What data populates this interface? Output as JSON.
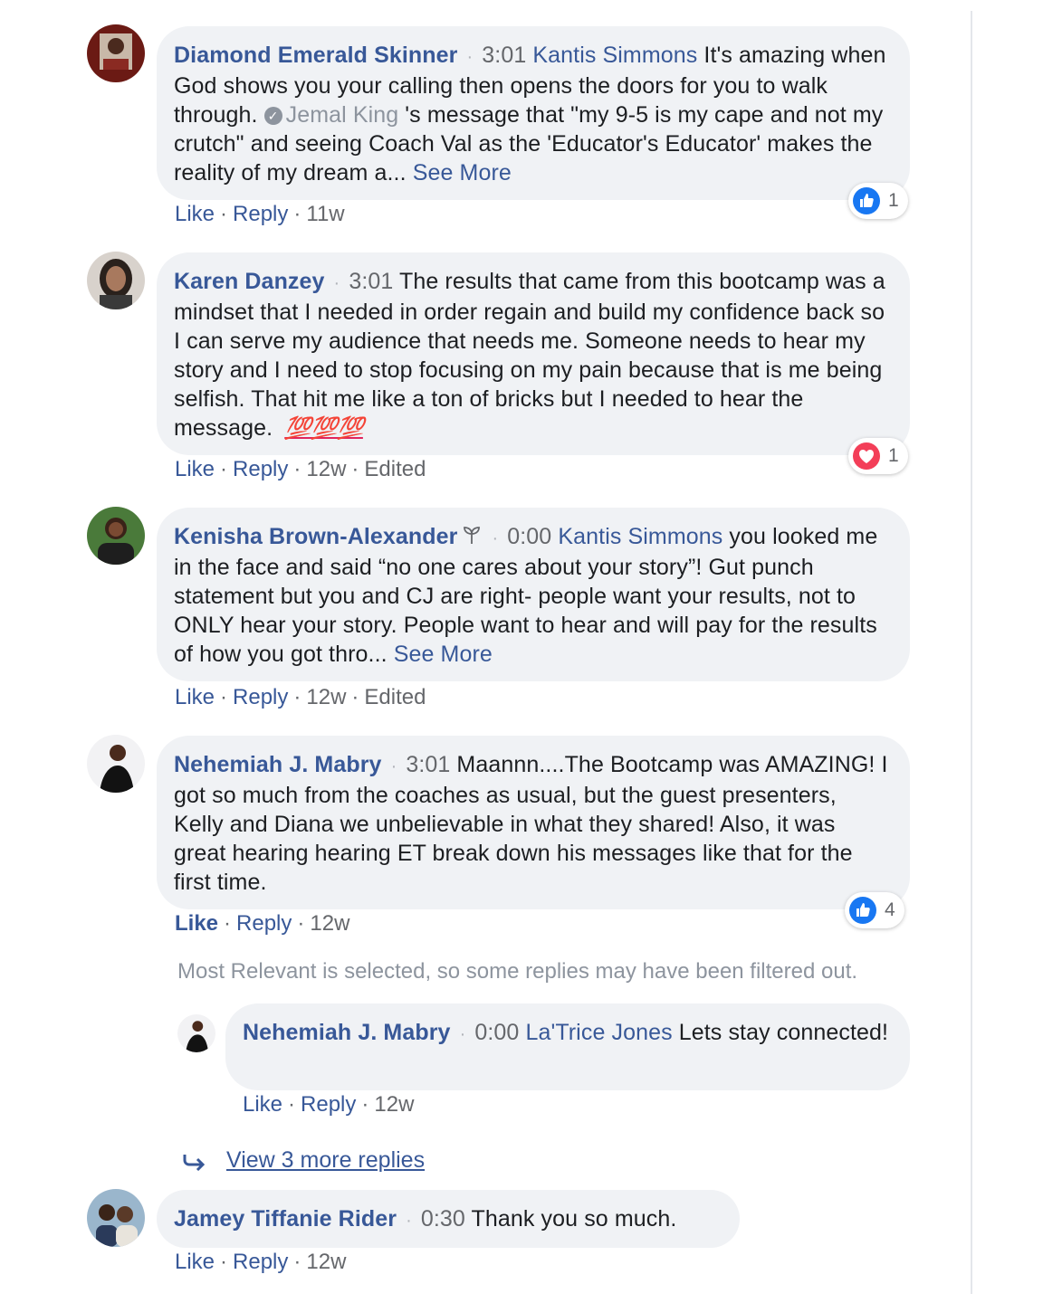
{
  "comments": [
    {
      "author": "Diamond Emerald Skinner",
      "time": "3:01",
      "mention": "Kantis Simmons",
      "text1": " It's amazing when God shows you your calling then opens the doors for you to walk through. ",
      "mention2": "Jemal King",
      "text2": " 's message that \"my 9-5 is my cape and not my crutch\" and seeing Coach Val as the 'Educator's Educator' makes the reality of my dream a... ",
      "see_more": "See More",
      "like": "Like",
      "reply": "Reply",
      "age": "11w",
      "reaction": {
        "type": "like",
        "count": "1"
      }
    },
    {
      "author": "Karen Danzey",
      "time": "3:01",
      "text1": " The results that came from this bootcamp was a mindset that I needed in order regain and build my confidence back so I can serve my audience that needs me. Someone needs to hear my story and I need to stop focusing on my pain because that is me being selfish. That hit me like a ton of bricks but I needed to hear the message. ",
      "emoji": "💯💯💯",
      "like": "Like",
      "reply": "Reply",
      "age": "12w",
      "edited": "Edited",
      "reaction": {
        "type": "love",
        "count": "1"
      }
    },
    {
      "author": "Kenisha Brown-Alexander",
      "time": "0:00",
      "mention": "Kantis Simmons",
      "text1": " you looked me in the face and said “no one cares about your story”! Gut punch statement but you and CJ are right- people want your results, not to ONLY hear your story. People want to hear and will pay for the results of how you got thro... ",
      "see_more": "See More",
      "like": "Like",
      "reply": "Reply",
      "age": "12w",
      "edited": "Edited"
    },
    {
      "author": "Nehemiah J. Mabry",
      "time": "3:01",
      "text1": " Maannn....The Bootcamp was AMAZING! I got so much from the coaches as usual, but the guest presenters, Kelly and Diana we unbelievable in what they shared! Also, it was great hearing hearing ET break down his messages like that for the first time.",
      "like": "Like",
      "reply": "Reply",
      "age": "12w",
      "reaction": {
        "type": "like",
        "count": "4"
      }
    },
    {
      "author": "Jamey Tiffanie Rider",
      "time": "0:30",
      "text1": " Thank you so much.",
      "like": "Like",
      "reply": "Reply",
      "age": "12w"
    }
  ],
  "reply": {
    "author": "Nehemiah J. Mabry",
    "time": "0:00",
    "mention": "La'Trice Jones",
    "text1": " Lets stay connected!",
    "like": "Like",
    "reply": "Reply",
    "age": "12w"
  },
  "notice": "Most Relevant is selected, so some replies may have been filtered out.",
  "view_more": "View 3 more replies",
  "separator_dot": "·",
  "colors": {
    "link_blue": "#385898",
    "bubble_bg": "#f0f2f5",
    "like_blue": "#1877f2",
    "love_red": "#f33e58"
  }
}
